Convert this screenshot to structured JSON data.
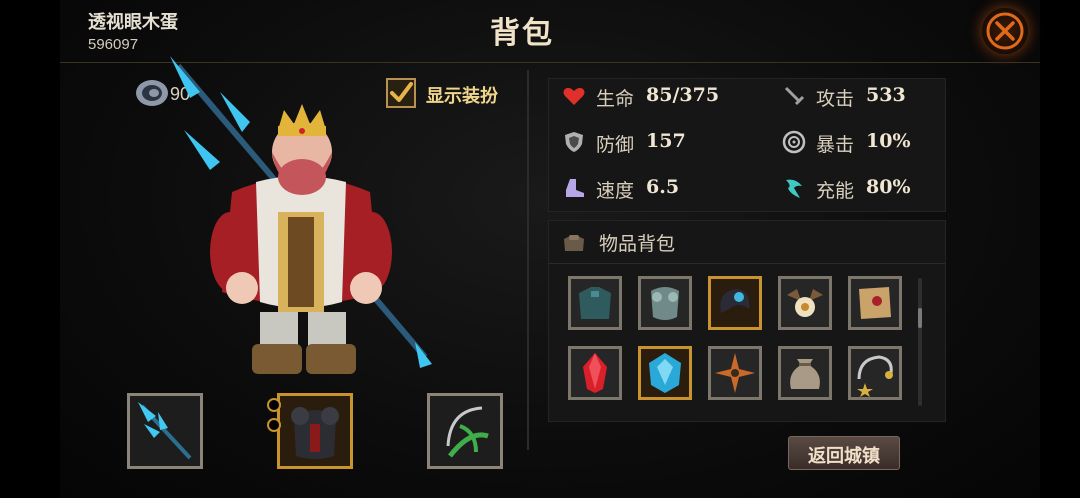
{
  "header": {
    "player_name": "透视眼木蛋",
    "player_id": "596097",
    "title": "背包",
    "close_icon": "close-icon"
  },
  "hero": {
    "level": "90",
    "show_outfit_label": "显示装扮",
    "show_outfit_checked": true
  },
  "equipment": [
    {
      "name": "weapon-spear",
      "icon": "spear-icon",
      "rarity": "common"
    },
    {
      "name": "armor-chest",
      "icon": "armor-icon",
      "rarity": "gold"
    },
    {
      "name": "accessory-bow",
      "icon": "bow-icon",
      "rarity": "common"
    }
  ],
  "stats": [
    {
      "key": "hp",
      "label": "生命",
      "value": "85/375",
      "icon": "heart-icon",
      "color": "#e0302a"
    },
    {
      "key": "attack",
      "label": "攻击",
      "value": "533",
      "icon": "sword-icon",
      "color": "#9a9a9a"
    },
    {
      "key": "defense",
      "label": "防御",
      "value": "157",
      "icon": "shield-icon",
      "color": "#b0b0b0"
    },
    {
      "key": "crit",
      "label": "暴击",
      "value": "10%",
      "icon": "crit-icon",
      "color": "#c0c0c0"
    },
    {
      "key": "speed",
      "label": "速度",
      "value": "6.5",
      "icon": "boot-icon",
      "color": "#b7a6e8"
    },
    {
      "key": "charge",
      "label": "充能",
      "value": "80%",
      "icon": "charge-icon",
      "color": "#3fc9c2"
    }
  ],
  "bag": {
    "title": "物品背包",
    "items": [
      {
        "name": "leather-armor",
        "rarity": "common"
      },
      {
        "name": "steel-gauntlet",
        "rarity": "common"
      },
      {
        "name": "dark-ring",
        "rarity": "gold"
      },
      {
        "name": "bone-talisman",
        "rarity": "common"
      },
      {
        "name": "old-scroll",
        "rarity": "common"
      },
      {
        "name": "red-crystal",
        "rarity": "common"
      },
      {
        "name": "blue-gem",
        "rarity": "gold"
      },
      {
        "name": "shuriken",
        "rarity": "common"
      },
      {
        "name": "cloth-pouch",
        "rarity": "common"
      },
      {
        "name": "star-bracelet",
        "rarity": "common"
      }
    ]
  },
  "actions": {
    "return_town": "返回城镇"
  },
  "colors": {
    "gold_border": "#c9932e",
    "common_border": "#7d766b",
    "accent_orange": "#e06a1a"
  }
}
